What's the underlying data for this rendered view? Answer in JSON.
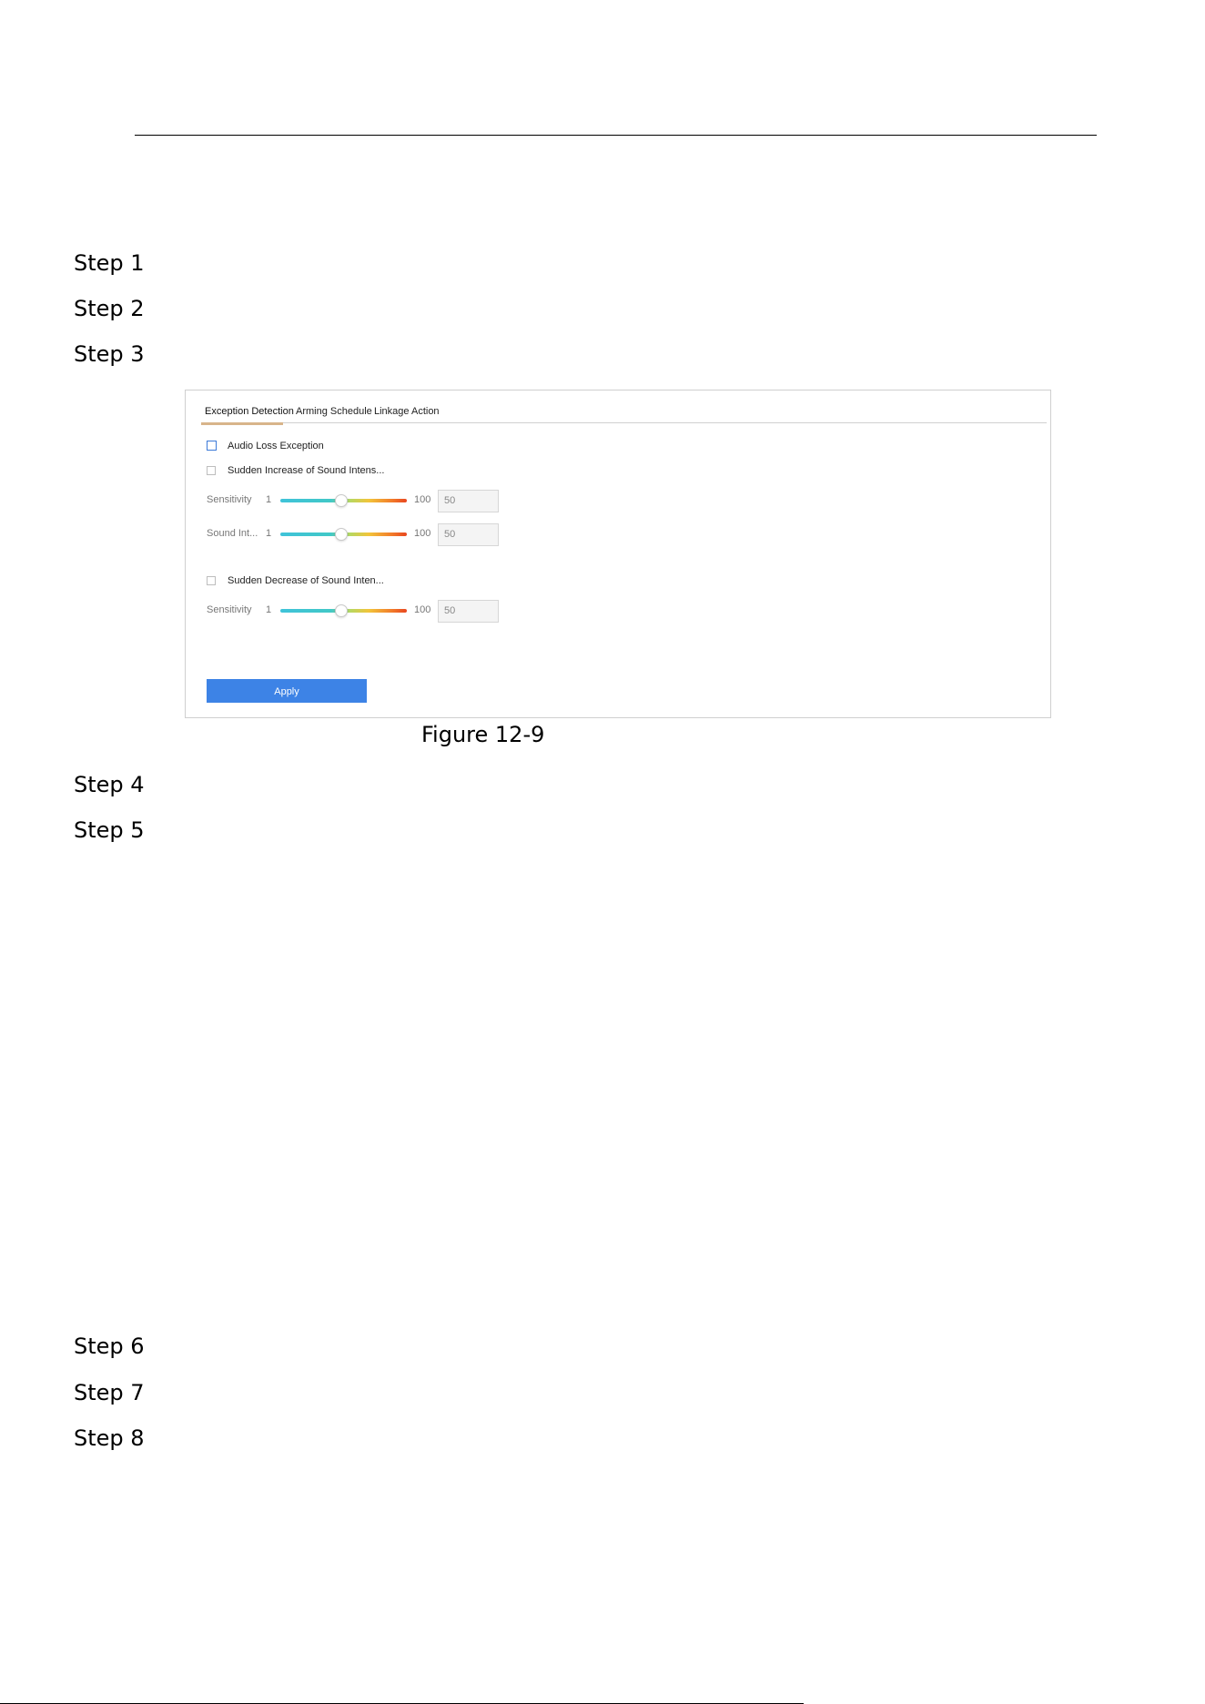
{
  "steps": [
    "Step 1",
    "Step 2",
    "Step 3",
    "Step 4",
    "Step 5",
    "Step 6",
    "Step 7",
    "Step 8"
  ],
  "figure": {
    "caption": "Figure 12-9",
    "tabs": [
      "Exception Detection",
      "Arming Schedule",
      "Linkage Action"
    ],
    "active_tab": "Exception Detection",
    "checkboxes": [
      {
        "label": "Audio Loss Exception",
        "checked": false
      },
      {
        "label": "Sudden Increase of Sound Intens...",
        "checked": false
      },
      {
        "label": "Sudden Decrease of Sound Inten...",
        "checked": false
      }
    ],
    "sliders": [
      {
        "label": "Sensitivity",
        "min": "1",
        "max": "100",
        "value": "50"
      },
      {
        "label": "Sound Int...",
        "min": "1",
        "max": "100",
        "value": "50"
      },
      {
        "label": "Sensitivity",
        "min": "1",
        "max": "100",
        "value": "50"
      }
    ],
    "apply_label": "Apply",
    "colors": {
      "apply": "#3d83e6",
      "active_tab_underline": "#d8b48a",
      "checkbox_focus": "#3c7ad8"
    }
  }
}
